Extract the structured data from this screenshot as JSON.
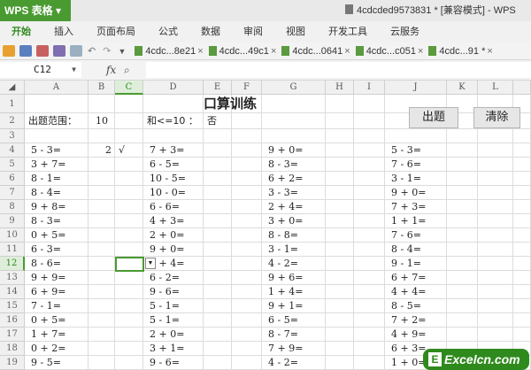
{
  "app": {
    "name": "WPS 表格",
    "doc_title": "4cdcded9573831 * [兼容模式] - WPS"
  },
  "menu": [
    "开始",
    "插入",
    "页面布局",
    "公式",
    "数据",
    "审阅",
    "视图",
    "开发工具",
    "云服务"
  ],
  "doc_tabs": [
    "4cdc...8e21",
    "4cdc...49c1",
    "4cdc...0641",
    "4cdc...c051",
    "4cdc...91 *"
  ],
  "formula_bar": {
    "name_box": "C12",
    "fx_label": "fx",
    "value": ""
  },
  "columns": [
    "A",
    "B",
    "C",
    "D",
    "E",
    "F",
    "G",
    "H",
    "I",
    "J",
    "K",
    "L"
  ],
  "selected_cell": "C12",
  "sheet": {
    "title": "口算训练",
    "range_label": "出题范围：",
    "range_value": "10",
    "sum_label": "和<=10 ：",
    "sum_value": "否",
    "b4": "2",
    "c4": "√",
    "col_a": [
      "5 - 3=",
      "3 + 7=",
      "8 - 1=",
      "8 - 4=",
      "9 + 8=",
      "8 - 3=",
      "0 + 5=",
      "6 - 3=",
      "8 - 6=",
      "9 + 9=",
      "6 + 9=",
      "7 - 1=",
      "0 + 5=",
      "1 + 7=",
      "0 + 2=",
      "9 - 5="
    ],
    "col_d": [
      "7 + 3=",
      "6 - 5=",
      "10 - 5=",
      "10 - 0=",
      "6 - 6=",
      "4 + 3=",
      "2 + 0=",
      "9 + 0=",
      "3 + 4=",
      "6 - 2=",
      "9 - 6=",
      "5 - 1=",
      "5 - 1=",
      "2 + 0=",
      "3 + 1=",
      "9 - 6="
    ],
    "col_g": [
      "9 + 0=",
      "8 - 3=",
      "6 + 2=",
      "3 - 3=",
      "2 + 4=",
      "3 + 0=",
      "8 - 8=",
      "3 - 1=",
      "4 - 2=",
      "9 + 6=",
      "1 + 4=",
      "9 + 1=",
      "6 - 5=",
      "8 - 7=",
      "7 + 9=",
      "4 - 2="
    ],
    "col_j": [
      "5 - 3=",
      "7 - 6=",
      "3 - 1=",
      "9 + 0=",
      "7 + 3=",
      "1 + 1=",
      "7 - 6=",
      "8 - 4=",
      "9 - 1=",
      "6 + 7=",
      "4 + 4=",
      "8 - 5=",
      "7 + 2=",
      "4 + 9=",
      "6 + 3=",
      "1 + 0="
    ]
  },
  "buttons": {
    "generate": "出题",
    "clear": "清除"
  },
  "watermark": "Excelcn.com",
  "colors": {
    "accent": "#4a9a32"
  }
}
